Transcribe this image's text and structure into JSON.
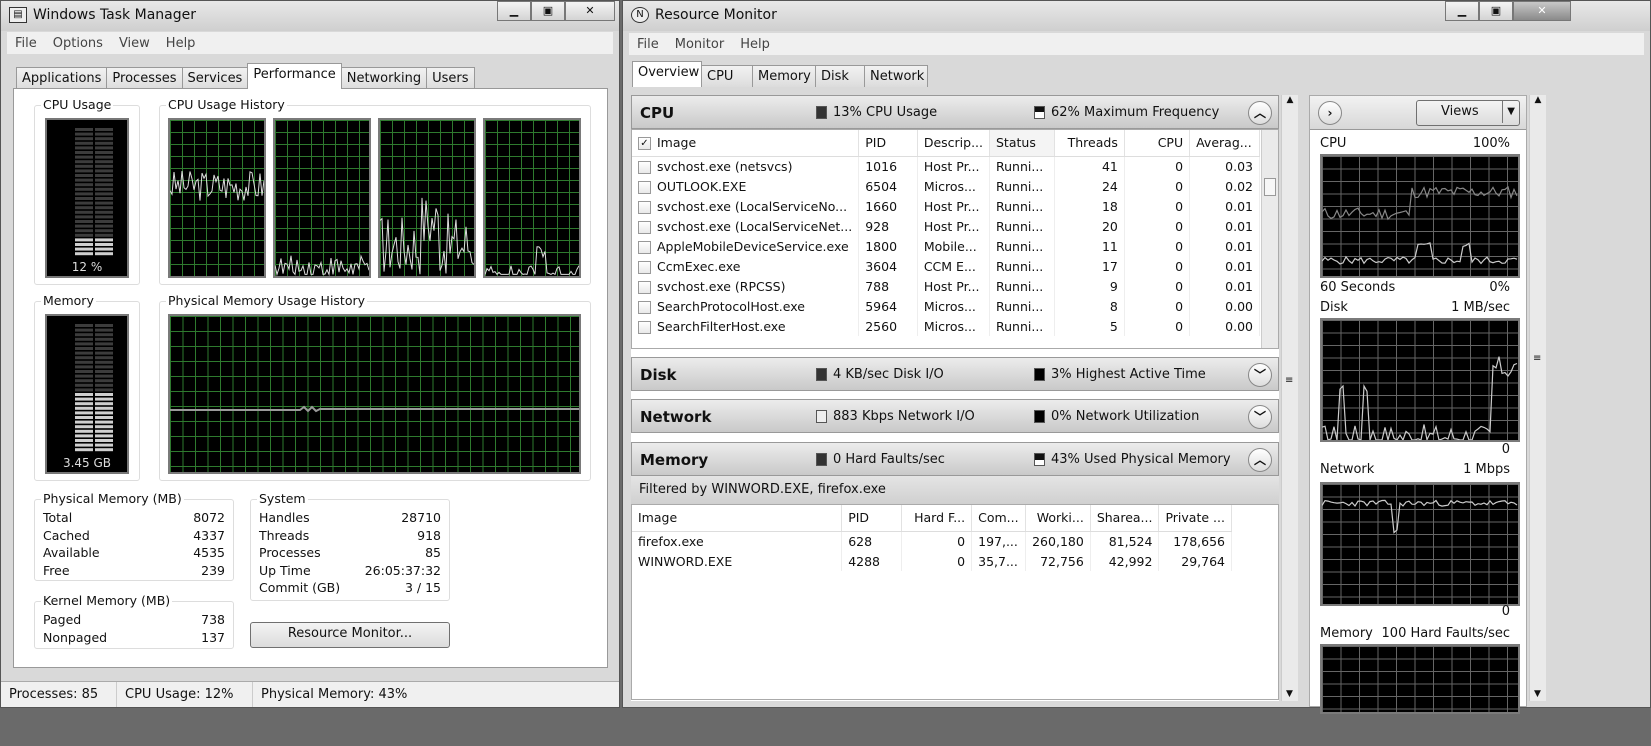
{
  "task_manager": {
    "title": "Windows Task Manager",
    "menu": [
      "File",
      "Options",
      "View",
      "Help"
    ],
    "tabs": [
      "Applications",
      "Processes",
      "Services",
      "Performance",
      "Networking",
      "Users"
    ],
    "active_tab": "Performance",
    "cpu_usage": {
      "label": "CPU Usage",
      "value_text": "12 %",
      "percent": 12
    },
    "cpu_history": {
      "label": "CPU Usage History",
      "cores": 4
    },
    "memory": {
      "label": "Memory",
      "value_text": "3.45 GB",
      "percent": 43
    },
    "memory_history": {
      "label": "Physical Memory Usage History"
    },
    "physical_memory": {
      "label": "Physical Memory (MB)",
      "rows": [
        {
          "key": "Total",
          "value": "8072"
        },
        {
          "key": "Cached",
          "value": "4337"
        },
        {
          "key": "Available",
          "value": "4535"
        },
        {
          "key": "Free",
          "value": "239"
        }
      ]
    },
    "kernel_memory": {
      "label": "Kernel Memory (MB)",
      "rows": [
        {
          "key": "Paged",
          "value": "738"
        },
        {
          "key": "Nonpaged",
          "value": "137"
        }
      ]
    },
    "system": {
      "label": "System",
      "rows": [
        {
          "key": "Handles",
          "value": "28710"
        },
        {
          "key": "Threads",
          "value": "918"
        },
        {
          "key": "Processes",
          "value": "85"
        },
        {
          "key": "Up Time",
          "value": "26:05:37:32"
        },
        {
          "key": "Commit (GB)",
          "value": "3 / 15"
        }
      ]
    },
    "resource_monitor_button": "Resource Monitor...",
    "status": {
      "processes": "Processes: 85",
      "cpu": "CPU Usage: 12%",
      "memory": "Physical Memory: 43%"
    }
  },
  "resource_monitor": {
    "title": "Resource Monitor",
    "menu": [
      "File",
      "Monitor",
      "Help"
    ],
    "tabs": [
      "Overview",
      "CPU",
      "Memory",
      "Disk",
      "Network"
    ],
    "active_tab": "Overview",
    "cpu": {
      "title": "CPU",
      "stat1": "13% CPU Usage",
      "stat2": "62% Maximum Frequency",
      "columns": [
        "Image",
        "PID",
        "Descrip...",
        "Status",
        "Threads",
        "CPU",
        "Averag..."
      ],
      "rows": [
        {
          "image": "svchost.exe (netsvcs)",
          "pid": "1016",
          "desc": "Host Pr...",
          "status": "Runni...",
          "threads": "41",
          "cpu": "0",
          "avg": "0.03"
        },
        {
          "image": "OUTLOOK.EXE",
          "pid": "6504",
          "desc": "Micros...",
          "status": "Runni...",
          "threads": "24",
          "cpu": "0",
          "avg": "0.02"
        },
        {
          "image": "svchost.exe (LocalServiceNo...",
          "pid": "1660",
          "desc": "Host Pr...",
          "status": "Runni...",
          "threads": "18",
          "cpu": "0",
          "avg": "0.01"
        },
        {
          "image": "svchost.exe (LocalServiceNet...",
          "pid": "928",
          "desc": "Host Pr...",
          "status": "Runni...",
          "threads": "20",
          "cpu": "0",
          "avg": "0.01"
        },
        {
          "image": "AppleMobileDeviceService.exe",
          "pid": "1800",
          "desc": "Mobile...",
          "status": "Runni...",
          "threads": "11",
          "cpu": "0",
          "avg": "0.01"
        },
        {
          "image": "CcmExec.exe",
          "pid": "3604",
          "desc": "CCM E...",
          "status": "Runni...",
          "threads": "17",
          "cpu": "0",
          "avg": "0.01"
        },
        {
          "image": "svchost.exe (RPCSS)",
          "pid": "788",
          "desc": "Host Pr...",
          "status": "Runni...",
          "threads": "9",
          "cpu": "0",
          "avg": "0.01"
        },
        {
          "image": "SearchProtocolHost.exe",
          "pid": "5964",
          "desc": "Micros...",
          "status": "Runni...",
          "threads": "8",
          "cpu": "0",
          "avg": "0.00"
        },
        {
          "image": "SearchFilterHost.exe",
          "pid": "2560",
          "desc": "Micros...",
          "status": "Runni...",
          "threads": "5",
          "cpu": "0",
          "avg": "0.00"
        }
      ]
    },
    "disk": {
      "title": "Disk",
      "stat1": "4 KB/sec Disk I/O",
      "stat2": "3% Highest Active Time"
    },
    "network": {
      "title": "Network",
      "stat1": "883 Kbps Network I/O",
      "stat2": "0% Network Utilization"
    },
    "memory": {
      "title": "Memory",
      "stat1": "0 Hard Faults/sec",
      "stat2": "43% Used Physical Memory",
      "filter": "Filtered by WINWORD.EXE, firefox.exe",
      "columns": [
        "Image",
        "PID",
        "Hard F...",
        "Com...",
        "Worki...",
        "Sharea...",
        "Private ..."
      ],
      "rows": [
        {
          "image": "firefox.exe",
          "pid": "628",
          "hard": "0",
          "commit": "197,...",
          "working": "260,180",
          "share": "81,524",
          "private": "178,656"
        },
        {
          "image": "WINWORD.EXE",
          "pid": "4288",
          "hard": "0",
          "commit": "35,7...",
          "working": "72,756",
          "share": "42,992",
          "private": "29,764"
        }
      ]
    },
    "side_panel": {
      "views_label": "Views",
      "charts": [
        {
          "name": "CPU",
          "max": "100%",
          "min": "0%",
          "footer": "60 Seconds"
        },
        {
          "name": "Disk",
          "max": "1 MB/sec",
          "min": "0"
        },
        {
          "name": "Network",
          "max": "1 Mbps",
          "min": "0"
        },
        {
          "name": "Memory",
          "max": "100 Hard Faults/sec"
        }
      ]
    }
  }
}
